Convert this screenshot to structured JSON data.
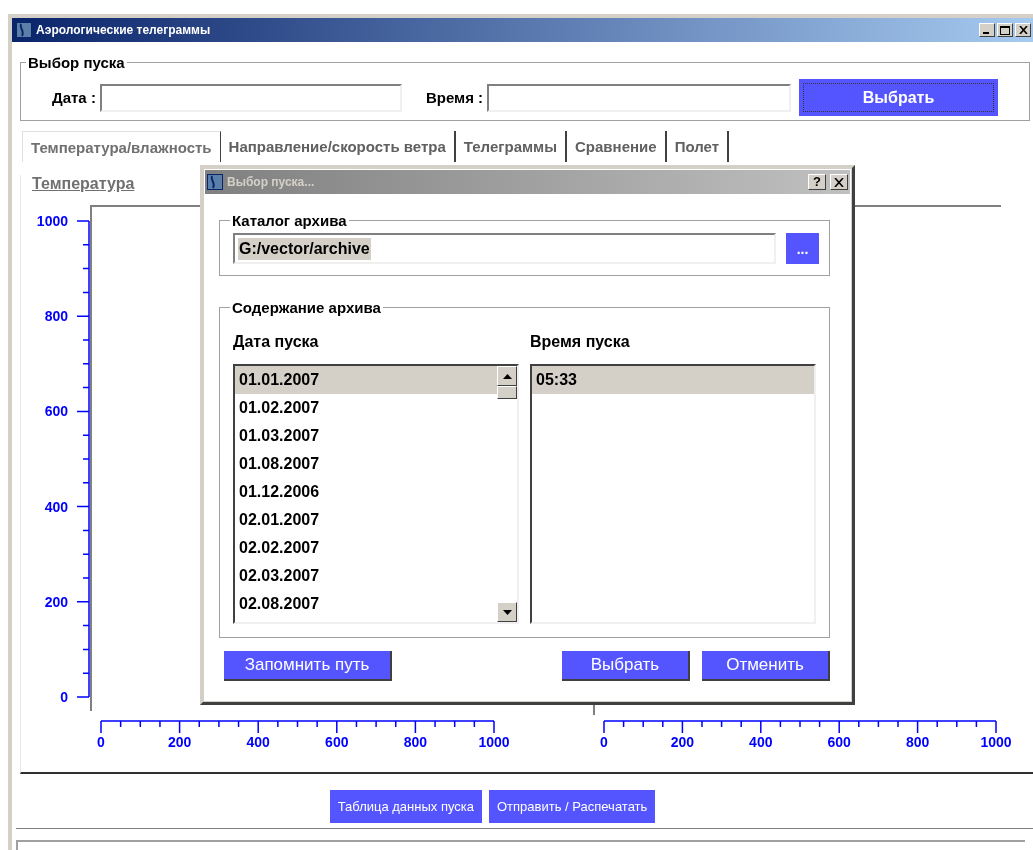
{
  "window": {
    "title": "Аэрологические телеграммы"
  },
  "launch_group": {
    "title": "Выбор пуска",
    "date_label": "Дата :",
    "time_label": "Время :",
    "button": "Выбрать"
  },
  "tabs": [
    {
      "label": "Температура/влажность",
      "selected": true
    },
    {
      "label": "Направление/скорость ветра",
      "selected": false
    },
    {
      "label": "Телеграммы",
      "selected": false
    },
    {
      "label": "Сравнение",
      "selected": false
    },
    {
      "label": "Полет",
      "selected": false
    }
  ],
  "chart_title": "Температура",
  "charts": [
    {
      "y_ticks": [
        "1000",
        "800",
        "600",
        "400",
        "200",
        "0"
      ],
      "x_ticks": [
        "0",
        "200",
        "400",
        "600",
        "800",
        "1000"
      ]
    },
    {
      "x_ticks": [
        "0",
        "200",
        "400",
        "600",
        "800",
        "1000"
      ]
    }
  ],
  "bottom_buttons": [
    "Таблица данных пуска",
    "Отправить / Распечатать"
  ],
  "dialog": {
    "title": "Выбор пуска...",
    "help_button": "?",
    "archive_group": {
      "title": "Каталог архива",
      "path": "G:/vector/archive",
      "browse_button": "..."
    },
    "contents_group": {
      "title": "Содержание архива",
      "dates_label": "Дата пуска",
      "times_label": "Время пуска",
      "dates": [
        {
          "text": "01.01.2007",
          "selected": true
        },
        {
          "text": "01.02.2007",
          "selected": false
        },
        {
          "text": "01.03.2007",
          "selected": false
        },
        {
          "text": "01.08.2007",
          "selected": false
        },
        {
          "text": "01.12.2006",
          "selected": false
        },
        {
          "text": "02.01.2007",
          "selected": false
        },
        {
          "text": "02.02.2007",
          "selected": false
        },
        {
          "text": "02.03.2007",
          "selected": false
        },
        {
          "text": "02.08.2007",
          "selected": false
        }
      ],
      "times": [
        {
          "text": "05:33",
          "selected": true
        }
      ]
    },
    "buttons": [
      "Запомнить путь",
      "Выбрать",
      "Отменить"
    ]
  }
}
